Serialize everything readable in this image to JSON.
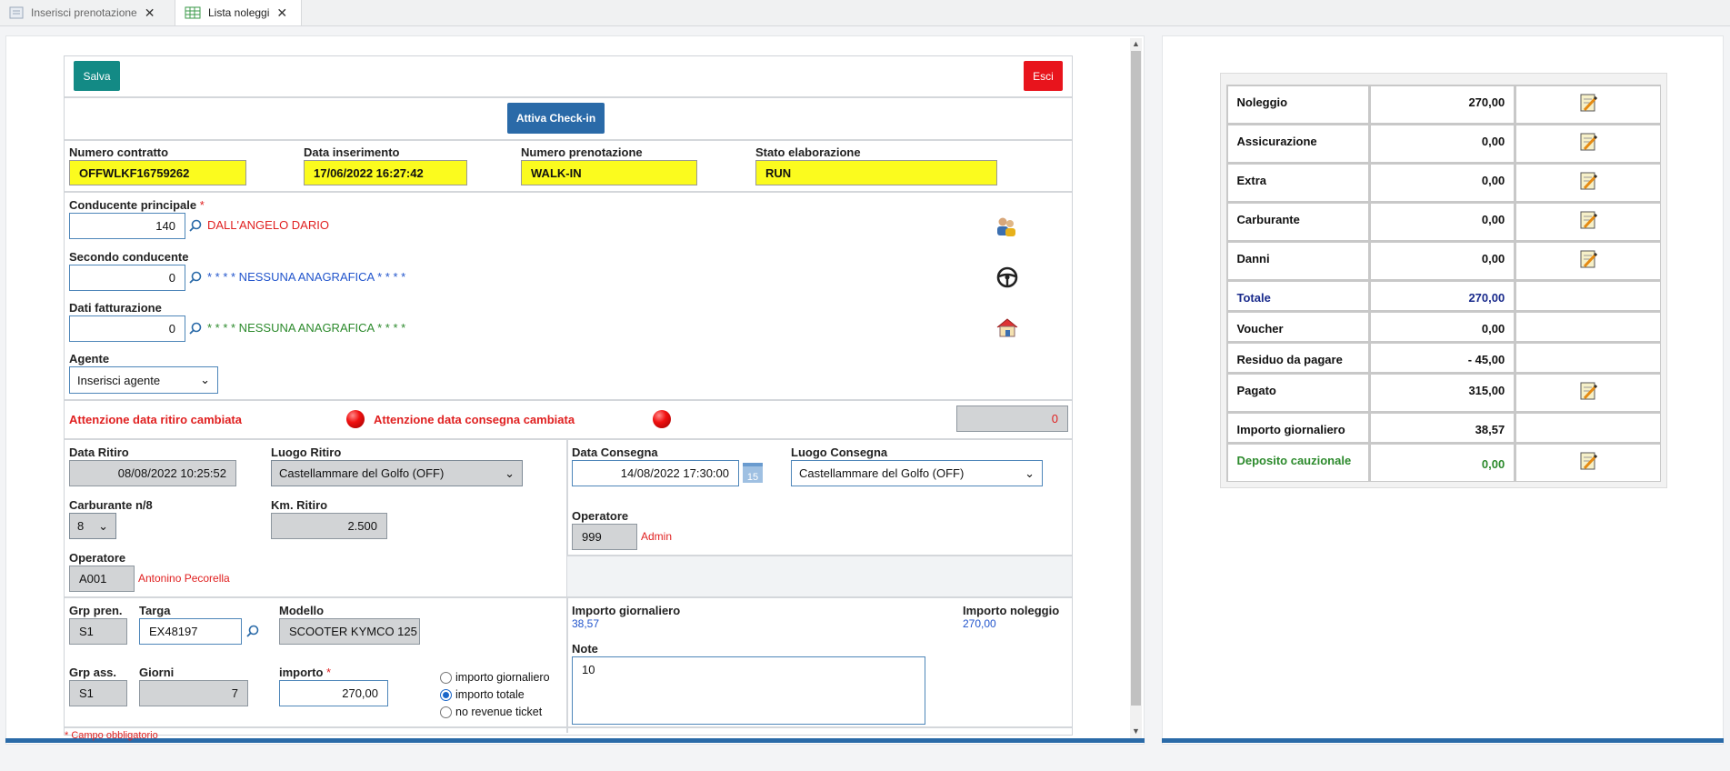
{
  "tabs": [
    {
      "label": "Inserisci prenotazione"
    },
    {
      "label": "Lista noleggi"
    }
  ],
  "toolbar": {
    "save": "Salva",
    "exit": "Esci",
    "checkin": "Attiva Check-in"
  },
  "contract": {
    "numero_contratto": {
      "label": "Numero contratto",
      "value": "OFFWLKF16759262"
    },
    "data_inserimento": {
      "label": "Data inserimento",
      "value": "17/06/2022 16:27:42"
    },
    "numero_prenotazione": {
      "label": "Numero prenotazione",
      "value": "WALK-IN"
    },
    "stato_elaborazione": {
      "label": "Stato elaborazione",
      "value": "RUN"
    }
  },
  "drivers": {
    "principale": {
      "label": "Conducente principale",
      "required": "*",
      "code": "140",
      "name": "DALL'ANGELO DARIO"
    },
    "secondo": {
      "label": "Secondo conducente",
      "code": "0",
      "name": "* * * * NESSUNA ANAGRAFICA * * * *"
    },
    "fatturazione": {
      "label": "Dati fatturazione",
      "code": "0",
      "name": "* * * * NESSUNA ANAGRAFICA * * * *"
    },
    "agente": {
      "label": "Agente",
      "selected": "Inserisci agente"
    }
  },
  "warnings": {
    "ritiro": "Attenzione data ritiro cambiata",
    "consegna": "Attenzione data consegna cambiata",
    "counter": "0"
  },
  "ritiro": {
    "data_label": "Data Ritiro",
    "data_value": "08/08/2022 10:25:52",
    "luogo_label": "Luogo Ritiro",
    "luogo_value": "Castellammare del Golfo (OFF)",
    "carburante_label": "Carburante n/8",
    "carburante_value": "8",
    "km_label": "Km. Ritiro",
    "km_value": "2.500",
    "operatore_label": "Operatore",
    "operatore_code": "A001",
    "operatore_name": "Antonino Pecorella"
  },
  "consegna": {
    "data_label": "Data Consegna",
    "data_value": "14/08/2022 17:30:00",
    "calendar_day": "15",
    "luogo_label": "Luogo Consegna",
    "luogo_value": "Castellammare del Golfo (OFF)",
    "operatore_label": "Operatore",
    "operatore_code": "999",
    "operatore_name": "Admin"
  },
  "vehicle": {
    "grp_pren_label": "Grp pren.",
    "grp_pren_value": "S1",
    "targa_label": "Targa",
    "targa_value": "EX48197",
    "modello_label": "Modello",
    "modello_value": "SCOOTER  KYMCO 125",
    "grp_ass_label": "Grp ass.",
    "grp_ass_value": "S1",
    "giorni_label": "Giorni",
    "giorni_value": "7",
    "importo_label": "importo",
    "importo_required": "*",
    "importo_value": "270,00",
    "radio": [
      {
        "label": "importo giornaliero",
        "checked": false
      },
      {
        "label": "importo totale",
        "checked": true
      },
      {
        "label": "no revenue ticket",
        "checked": false
      }
    ]
  },
  "amounts": {
    "giornaliero_label": "Importo giornaliero",
    "giornaliero_value": "38,57",
    "noleggio_label": "Importo noleggio",
    "noleggio_value": "270,00",
    "note_label": "Note",
    "note_value": "10"
  },
  "footer_note": "* Campo obbligatorio",
  "summary": [
    {
      "label": "Noleggio",
      "value": "270,00",
      "edit": true,
      "color": "#111111"
    },
    {
      "label": "Assicurazione",
      "value": "0,00",
      "edit": true,
      "color": "#111111"
    },
    {
      "label": "Extra",
      "value": "0,00",
      "edit": true,
      "color": "#111111"
    },
    {
      "label": "Carburante",
      "value": "0,00",
      "edit": true,
      "color": "#111111"
    },
    {
      "label": "Danni",
      "value": "0,00",
      "edit": true,
      "color": "#111111"
    },
    {
      "label": "Totale",
      "value": "270,00",
      "edit": false,
      "color": "#1a2b8c"
    },
    {
      "label": "Voucher",
      "value": "0,00",
      "edit": false,
      "color": "#111111"
    },
    {
      "label": "Residuo da pagare",
      "value": "- 45,00",
      "edit": false,
      "color": "#111111"
    },
    {
      "label": "Pagato",
      "value": "315,00",
      "edit": true,
      "color": "#111111"
    },
    {
      "label": "Importo giornaliero",
      "value": "38,57",
      "edit": false,
      "color": "#111111"
    },
    {
      "label": "Deposito cauzionale",
      "value": "0,00",
      "edit": true,
      "color": "#2c8a2c"
    }
  ]
}
